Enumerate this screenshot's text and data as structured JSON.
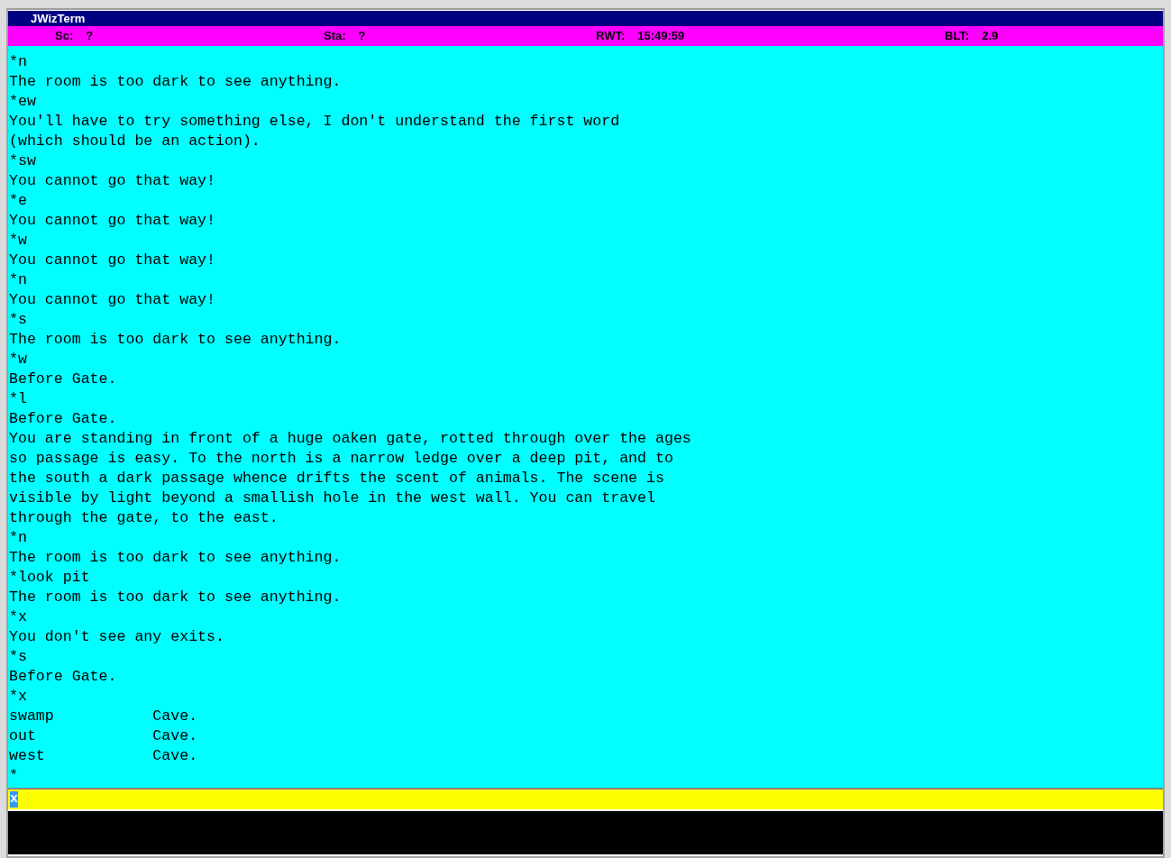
{
  "window": {
    "title": "JWizTerm"
  },
  "status_bar": [
    {
      "label": "Sc:",
      "value": "?"
    },
    {
      "label": "Sta:",
      "value": "?"
    },
    {
      "label": "RWT:",
      "value": "15:49:59"
    },
    {
      "label": "BLT:",
      "value": "2.9"
    }
  ],
  "terminal_lines": [
    "*n",
    "The room is too dark to see anything.",
    "*ew",
    "You'll have to try something else, I don't understand the first word",
    "(which should be an action).",
    "*sw",
    "You cannot go that way!",
    "*e",
    "You cannot go that way!",
    "*w",
    "You cannot go that way!",
    "*n",
    "You cannot go that way!",
    "*s",
    "The room is too dark to see anything.",
    "*w",
    "Before Gate.",
    "*l",
    "Before Gate.",
    "You are standing in front of a huge oaken gate, rotted through over the ages",
    "so passage is easy. To the north is a narrow ledge over a deep pit, and to",
    "the south a dark passage whence drifts the scent of animals. The scene is",
    "visible by light beyond a smallish hole in the west wall. You can travel",
    "through the gate, to the east.",
    "*n",
    "The room is too dark to see anything.",
    "*look pit",
    "The room is too dark to see anything.",
    "*x",
    "You don't see any exits.",
    "*s",
    "Before Gate.",
    "*x",
    "swamp           Cave.",
    "out             Cave.",
    "west            Cave.",
    "*"
  ],
  "input": {
    "value": "x",
    "selected": true
  }
}
